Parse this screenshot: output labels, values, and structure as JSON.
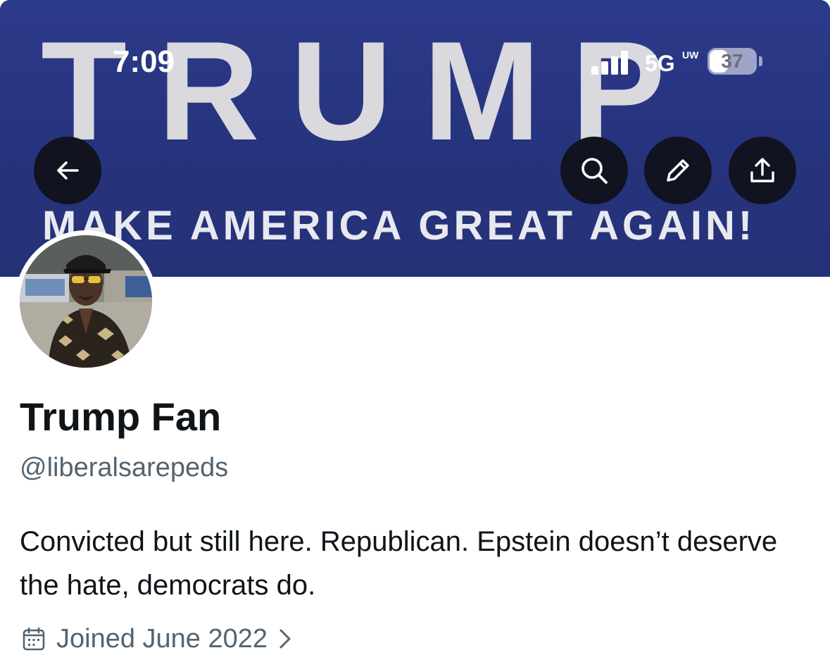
{
  "status_bar": {
    "time": "7:09",
    "network": "5G",
    "network_sub": "UW",
    "battery": "37",
    "battery_level": 0.37
  },
  "banner": {
    "headline": "TRUMP",
    "slogan": "MAKE AMERICA GREAT AGAIN!",
    "background_color": "#283580"
  },
  "profile": {
    "display_name": "Trump Fan",
    "handle": "@liberalsarepeds",
    "bio": "Convicted but still here. Republican. Epstein doesn’t deserve the hate, democrats do.",
    "joined": "Joined June 2022"
  },
  "icons": {
    "back": "back-arrow-icon",
    "search": "search-icon",
    "edit": "pencil-icon",
    "share": "share-icon",
    "calendar": "calendar-icon",
    "chevron": "chevron-right-icon"
  }
}
